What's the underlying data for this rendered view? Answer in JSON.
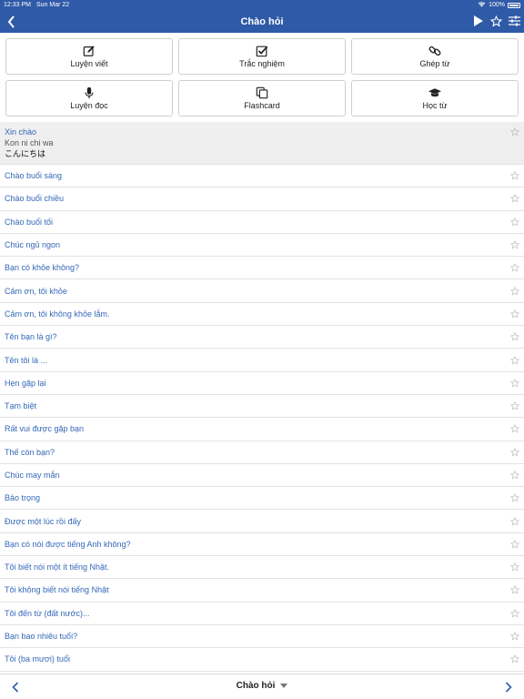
{
  "status": {
    "time": "12:33 PM",
    "date": "Sun Mar 22",
    "battery": "100%"
  },
  "nav": {
    "title": "Chào hỏi"
  },
  "actions": [
    {
      "label": "Luyện viết",
      "icon": "edit-icon"
    },
    {
      "label": "Trắc nghiệm",
      "icon": "checkbox-icon"
    },
    {
      "label": "Ghép từ",
      "icon": "link-icon"
    },
    {
      "label": "Luyện đọc",
      "icon": "microphone-icon"
    },
    {
      "label": "Flashcard",
      "icon": "copy-icon"
    },
    {
      "label": "Học từ",
      "icon": "graduation-cap-icon"
    }
  ],
  "selected": {
    "vi": "Xin chào",
    "romaji": "Kon ni chi wa",
    "jp": "こんにちは"
  },
  "phrases": [
    "Chào buổi sáng",
    "Chào buổi chiều",
    "Chào buổi tối",
    "Chúc ngủ ngon",
    "Bạn có khỏe không?",
    "Cảm ơn, tôi khỏe",
    "Cảm ơn, tôi không khỏe lắm.",
    "Tên bạn là gì?",
    "Tên tôi là ...",
    "Hẹn gặp lại",
    "Tạm biệt",
    "Rất vui được gặp bạn",
    "Thế còn bạn?",
    "Chúc may mắn",
    "Bảo trọng",
    "Được một lúc rồi đấy",
    "Bạn có nói được tiếng Anh không?",
    "Tôi biết nói một ít tiếng Nhật.",
    "Tôi không biết nói tiếng Nhật",
    "Tôi đến từ (đất nước)...",
    "Bạn bao nhiêu tuổi?",
    "Tôi (ba mươi) tuổi"
  ],
  "bottom": {
    "title": "Chào hỏi"
  },
  "colors": {
    "accent": "#2f5aa7",
    "link": "#3468b8"
  }
}
